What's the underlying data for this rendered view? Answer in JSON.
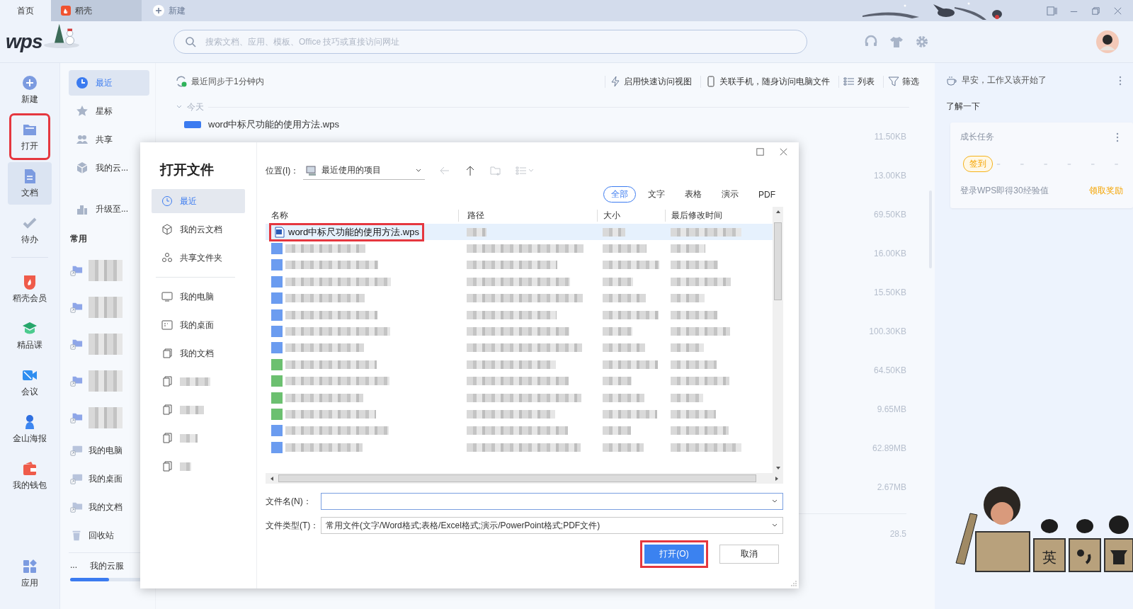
{
  "tabs": [
    {
      "label": "首页",
      "kind": "home",
      "selected": true
    },
    {
      "label": "稻壳",
      "kind": "docer",
      "selected": false
    }
  ],
  "new_tab_button": {
    "label": "新建"
  },
  "logo": {
    "text": "wps"
  },
  "search": {
    "placeholder": "搜索文档、应用、模板、Office 技巧或直接访问网址"
  },
  "nav": [
    {
      "label": "新建",
      "kind": "plus",
      "selected": false,
      "highlighted": false
    },
    {
      "label": "打开",
      "kind": "folder",
      "selected": false,
      "highlighted": true
    },
    {
      "label": "文档",
      "kind": "doc",
      "selected": true,
      "highlighted": false
    },
    {
      "label": "待办",
      "kind": "check",
      "selected": false,
      "highlighted": false
    }
  ],
  "nav_apps": [
    {
      "label": "稻壳会员",
      "kind": "docer"
    },
    {
      "label": "精品课",
      "kind": "course"
    },
    {
      "label": "会议",
      "kind": "meeting"
    },
    {
      "label": "金山海报",
      "kind": "poster"
    },
    {
      "label": "我的钱包",
      "kind": "wallet"
    }
  ],
  "apps_button": {
    "label": "应用"
  },
  "sidebar": {
    "items": [
      {
        "label": "最近",
        "kind": "clock",
        "selected": true
      },
      {
        "label": "星标",
        "kind": "star",
        "selected": false
      },
      {
        "label": "共享",
        "kind": "people",
        "selected": false
      },
      {
        "label": "我的云...",
        "kind": "cube",
        "selected": false
      }
    ],
    "upgrade": "升级至...",
    "common_heading": "常用",
    "common_items": [
      {
        "kind": "redacted"
      },
      {
        "kind": "redacted"
      },
      {
        "kind": "redacted"
      },
      {
        "kind": "redacted"
      },
      {
        "kind": "redacted"
      },
      {
        "kind": "computer",
        "label": "我的电脑"
      },
      {
        "kind": "desktop",
        "label": "我的桌面"
      },
      {
        "kind": "docs",
        "label": "我的文档"
      }
    ],
    "trash": "回收站",
    "cloud": {
      "more": "...",
      "label": "我的云服",
      "level": 0.5
    }
  },
  "main": {
    "sync_status": "最近同步于1分钟内",
    "actions": [
      {
        "kind": "bolt",
        "label": "启用快速访问视图"
      },
      {
        "kind": "phone",
        "label": "关联手机，随身访问电脑文件"
      },
      {
        "kind": "list",
        "label": "列表"
      },
      {
        "kind": "filter",
        "label": "筛选"
      }
    ],
    "group_label": "今天",
    "files": [
      {
        "name": "word中标尺功能的使用方法.wps",
        "size": "11.50KB"
      },
      {
        "size": "13.00KB"
      },
      {
        "size": "69.50KB"
      },
      {
        "size": "16.00KB"
      },
      {
        "size": "15.50KB"
      },
      {
        "size": "100.30KB"
      },
      {
        "size": "64.50KB"
      },
      {
        "size": "9.65MB"
      },
      {
        "size": "62.89MB"
      },
      {
        "size": "2.67MB"
      }
    ],
    "earlier_files": [
      {
        "size": "28.5"
      }
    ]
  },
  "right_panel": {
    "greeting": "早安，工作又该开始了",
    "learn_heading": "了解一下",
    "task_card": {
      "title": "成长任务",
      "checkin": "签到",
      "description": "登录WPS即得30经验值",
      "reward": "领取奖励"
    }
  },
  "ime": {
    "mode": "英"
  },
  "dialog": {
    "title": "打开文件",
    "places_top": [
      {
        "kind": "clock",
        "label": "最近",
        "selected": true
      },
      {
        "kind": "cube",
        "label": "我的云文档",
        "selected": false
      },
      {
        "kind": "shared",
        "label": "共享文件夹",
        "selected": false
      }
    ],
    "places_bottom": [
      {
        "kind": "computer",
        "label": "我的电脑",
        "selected": false
      },
      {
        "kind": "desktop",
        "label": "我的桌面",
        "selected": false
      },
      {
        "kind": "docs",
        "label": "我的文档",
        "selected": false
      },
      {
        "kind": "redacted",
        "selected": false
      },
      {
        "kind": "redacted",
        "selected": false
      },
      {
        "kind": "redacted",
        "selected": false
      },
      {
        "kind": "redacted",
        "selected": false
      }
    ],
    "location_label": "位置(I)：",
    "location": "最近使用的项目",
    "filters": [
      {
        "label": "全部",
        "selected": true
      },
      {
        "label": "文字",
        "selected": false
      },
      {
        "label": "表格",
        "selected": false
      },
      {
        "label": "演示",
        "selected": false
      },
      {
        "label": "PDF",
        "selected": false
      }
    ],
    "columns": [
      "名称",
      "路径",
      "大小",
      "最后修改时间"
    ],
    "rows": [
      {
        "kind": "file",
        "name": "word中标尺功能的使用方法.wps",
        "selected": true,
        "highlighted": true
      },
      {
        "kind": "redacted",
        "color": "#6b9cf0",
        "selected": false
      },
      {
        "kind": "redacted",
        "color": "#6b9cf0",
        "selected": false
      },
      {
        "kind": "redacted",
        "color": "#6b9cf0",
        "selected": false
      },
      {
        "kind": "redacted",
        "color": "#6b9cf0",
        "selected": false
      },
      {
        "kind": "redacted",
        "color": "#6b9cf0",
        "selected": false
      },
      {
        "kind": "redacted",
        "color": "#6b9cf0",
        "selected": false
      },
      {
        "kind": "redacted",
        "color": "#6b9cf0",
        "selected": false
      },
      {
        "kind": "redacted",
        "color": "#6cc070",
        "selected": false
      },
      {
        "kind": "redacted",
        "color": "#6cc070",
        "selected": false
      },
      {
        "kind": "redacted",
        "color": "#6cc070",
        "selected": false
      },
      {
        "kind": "redacted",
        "color": "#6cc070",
        "selected": false
      },
      {
        "kind": "redacted",
        "color": "#6b9cf0",
        "selected": false
      },
      {
        "kind": "redacted",
        "color": "#6b9cf0",
        "selected": false
      }
    ],
    "filename_label": "文件名(N)：",
    "filetype_label": "文件类型(T)：",
    "filetype": "常用文件(文字/Word格式;表格/Excel格式;演示/PowerPoint格式;PDF文件)",
    "buttons": [
      {
        "label": "打开(O)",
        "kind": "primary",
        "highlighted": true
      },
      {
        "label": "取消",
        "kind": "secondary",
        "highlighted": false
      }
    ]
  }
}
